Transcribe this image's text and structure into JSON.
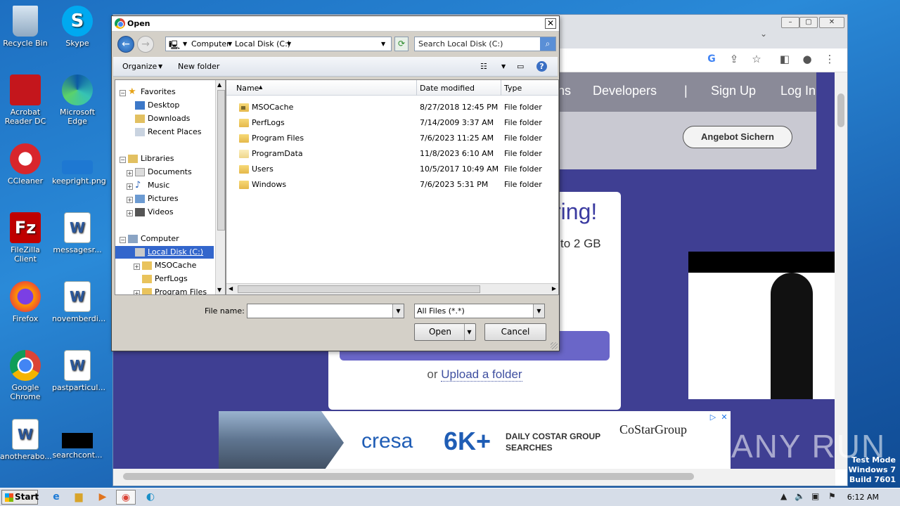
{
  "desktop": {
    "icons": [
      {
        "label": "Recycle Bin"
      },
      {
        "label": "Skype"
      },
      {
        "label": "Acrobat Reader DC"
      },
      {
        "label": "Microsoft Edge"
      },
      {
        "label": "CCleaner"
      },
      {
        "label": "keepright.png"
      },
      {
        "label": "FileZilla Client"
      },
      {
        "label": "messagesr..."
      },
      {
        "label": "Firefox"
      },
      {
        "label": "novemberdi..."
      },
      {
        "label": "Google Chrome"
      },
      {
        "label": "pastparticul..."
      },
      {
        "label": "anotherabo..."
      },
      {
        "label": "searchcont..."
      }
    ]
  },
  "browser": {
    "nav": {
      "item1": "ns",
      "item2": "Developers",
      "separator": "|",
      "signup": "Sign Up",
      "login": "Log In"
    },
    "cta": "Angebot Sichern",
    "card": {
      "heading": "ring!",
      "sub": "to 2 GB",
      "or": "or",
      "upload_folder": "Upload a folder"
    },
    "ad": {
      "brand": "cresa",
      "big": "6K+",
      "text": "DAILY COSTAR GROUP SEARCHES",
      "partner": "CoStarGroup"
    }
  },
  "watermark": "ANY RUN",
  "testmode": {
    "line1": "Test Mode",
    "line2": "Windows 7",
    "line3": "Build 7601"
  },
  "taskbar": {
    "start": "Start",
    "clock": "6:12 AM"
  },
  "dialog": {
    "title": "Open",
    "breadcrumb": [
      "Computer",
      "Local Disk (C:)"
    ],
    "search_placeholder": "Search Local Disk (C:)",
    "toolbar": {
      "organize": "Organize",
      "new_folder": "New folder"
    },
    "tree": {
      "favorites": "Favorites",
      "desktop": "Desktop",
      "downloads": "Downloads",
      "recent": "Recent Places",
      "libraries": "Libraries",
      "documents": "Documents",
      "music": "Music",
      "pictures": "Pictures",
      "videos": "Videos",
      "computer": "Computer",
      "local_disk": "Local Disk (C:)",
      "msocache": "MSOCache",
      "perflogs": "PerfLogs",
      "program_files": "Program Files"
    },
    "columns": {
      "name": "Name",
      "date": "Date modified",
      "type": "Type"
    },
    "files": [
      {
        "name": "MSOCache",
        "date": "8/27/2018 12:45 PM",
        "type": "File folder"
      },
      {
        "name": "PerfLogs",
        "date": "7/14/2009 3:37 AM",
        "type": "File folder"
      },
      {
        "name": "Program Files",
        "date": "7/6/2023 11:25 AM",
        "type": "File folder"
      },
      {
        "name": "ProgramData",
        "date": "11/8/2023 6:10 AM",
        "type": "File folder"
      },
      {
        "name": "Users",
        "date": "10/5/2017 10:49 AM",
        "type": "File folder"
      },
      {
        "name": "Windows",
        "date": "7/6/2023 5:31 PM",
        "type": "File folder"
      }
    ],
    "file_name_label": "File name:",
    "file_name_value": "",
    "file_type": "All Files (*.*)",
    "open_label": "Open",
    "cancel_label": "Cancel"
  }
}
